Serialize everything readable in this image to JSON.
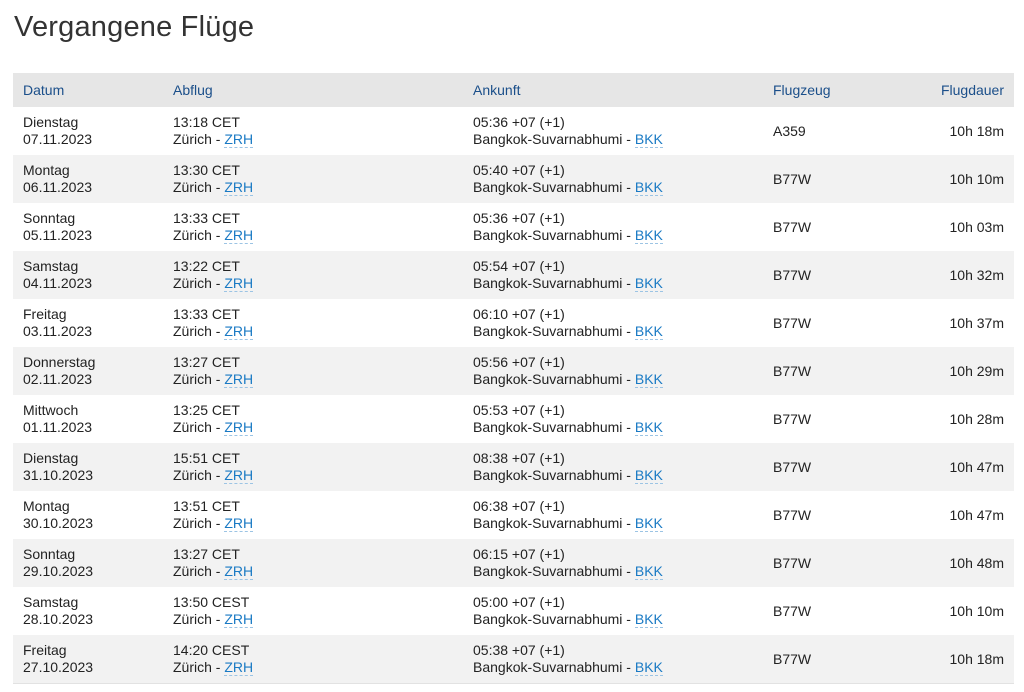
{
  "page": {
    "title": "Vergangene Flüge"
  },
  "table": {
    "headers": {
      "date": "Datum",
      "departure": "Abflug",
      "arrival": "Ankunft",
      "aircraft": "Flugzeug",
      "duration": "Flugdauer"
    },
    "rows": [
      {
        "weekday": "Dienstag",
        "date": "07.11.2023",
        "dep_time": "13:18 CET",
        "dep_city": "Zürich - ",
        "dep_code": "ZRH",
        "arr_time": "05:36 +07 (+1)",
        "arr_city": "Bangkok-Suvarnabhumi - ",
        "arr_code": "BKK",
        "aircraft": "A359",
        "duration": "10h 18m"
      },
      {
        "weekday": "Montag",
        "date": "06.11.2023",
        "dep_time": "13:30 CET",
        "dep_city": "Zürich - ",
        "dep_code": "ZRH",
        "arr_time": "05:40 +07 (+1)",
        "arr_city": "Bangkok-Suvarnabhumi - ",
        "arr_code": "BKK",
        "aircraft": "B77W",
        "duration": "10h 10m"
      },
      {
        "weekday": "Sonntag",
        "date": "05.11.2023",
        "dep_time": "13:33 CET",
        "dep_city": "Zürich - ",
        "dep_code": "ZRH",
        "arr_time": "05:36 +07 (+1)",
        "arr_city": "Bangkok-Suvarnabhumi - ",
        "arr_code": "BKK",
        "aircraft": "B77W",
        "duration": "10h 03m"
      },
      {
        "weekday": "Samstag",
        "date": "04.11.2023",
        "dep_time": "13:22 CET",
        "dep_city": "Zürich - ",
        "dep_code": "ZRH",
        "arr_time": "05:54 +07 (+1)",
        "arr_city": "Bangkok-Suvarnabhumi - ",
        "arr_code": "BKK",
        "aircraft": "B77W",
        "duration": "10h 32m"
      },
      {
        "weekday": "Freitag",
        "date": "03.11.2023",
        "dep_time": "13:33 CET",
        "dep_city": "Zürich - ",
        "dep_code": "ZRH",
        "arr_time": "06:10 +07 (+1)",
        "arr_city": "Bangkok-Suvarnabhumi - ",
        "arr_code": "BKK",
        "aircraft": "B77W",
        "duration": "10h 37m"
      },
      {
        "weekday": "Donnerstag",
        "date": "02.11.2023",
        "dep_time": "13:27 CET",
        "dep_city": "Zürich - ",
        "dep_code": "ZRH",
        "arr_time": "05:56 +07 (+1)",
        "arr_city": "Bangkok-Suvarnabhumi - ",
        "arr_code": "BKK",
        "aircraft": "B77W",
        "duration": "10h 29m"
      },
      {
        "weekday": "Mittwoch",
        "date": "01.11.2023",
        "dep_time": "13:25 CET",
        "dep_city": "Zürich - ",
        "dep_code": "ZRH",
        "arr_time": "05:53 +07 (+1)",
        "arr_city": "Bangkok-Suvarnabhumi - ",
        "arr_code": "BKK",
        "aircraft": "B77W",
        "duration": "10h 28m"
      },
      {
        "weekday": "Dienstag",
        "date": "31.10.2023",
        "dep_time": "15:51 CET",
        "dep_city": "Zürich - ",
        "dep_code": "ZRH",
        "arr_time": "08:38 +07 (+1)",
        "arr_city": "Bangkok-Suvarnabhumi - ",
        "arr_code": "BKK",
        "aircraft": "B77W",
        "duration": "10h 47m"
      },
      {
        "weekday": "Montag",
        "date": "30.10.2023",
        "dep_time": "13:51 CET",
        "dep_city": "Zürich - ",
        "dep_code": "ZRH",
        "arr_time": "06:38 +07 (+1)",
        "arr_city": "Bangkok-Suvarnabhumi - ",
        "arr_code": "BKK",
        "aircraft": "B77W",
        "duration": "10h 47m"
      },
      {
        "weekday": "Sonntag",
        "date": "29.10.2023",
        "dep_time": "13:27 CET",
        "dep_city": "Zürich - ",
        "dep_code": "ZRH",
        "arr_time": "06:15 +07 (+1)",
        "arr_city": "Bangkok-Suvarnabhumi - ",
        "arr_code": "BKK",
        "aircraft": "B77W",
        "duration": "10h 48m"
      },
      {
        "weekday": "Samstag",
        "date": "28.10.2023",
        "dep_time": "13:50 CEST",
        "dep_city": "Zürich - ",
        "dep_code": "ZRH",
        "arr_time": "05:00 +07 (+1)",
        "arr_city": "Bangkok-Suvarnabhumi - ",
        "arr_code": "BKK",
        "aircraft": "B77W",
        "duration": "10h 10m"
      },
      {
        "weekday": "Freitag",
        "date": "27.10.2023",
        "dep_time": "14:20 CEST",
        "dep_city": "Zürich - ",
        "dep_code": "ZRH",
        "arr_time": "05:38 +07 (+1)",
        "arr_city": "Bangkok-Suvarnabhumi - ",
        "arr_code": "BKK",
        "aircraft": "B77W",
        "duration": "10h 18m"
      }
    ]
  },
  "colors": {
    "header_bg": "#e6e6e6",
    "header_text": "#1b4f8a",
    "link": "#1a7ac4",
    "row_alt": "#f2f2f2"
  }
}
